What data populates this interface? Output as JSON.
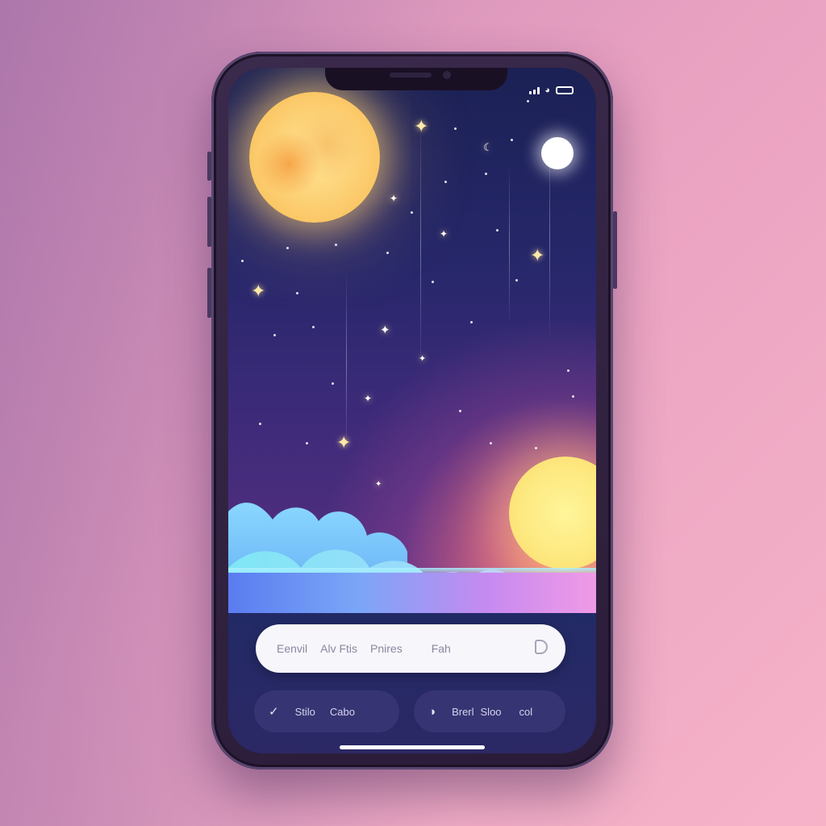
{
  "status_bar": {
    "icons": [
      "signal-icon",
      "wifi-icon",
      "battery-icon"
    ]
  },
  "search": {
    "segments": [
      "Eenvil",
      "Alv Ftis",
      "Pnires",
      "Fah"
    ],
    "icon": "search-icon"
  },
  "buttons": {
    "left": {
      "icon": "check-icon",
      "labels": [
        "Stilo",
        "Cabo"
      ]
    },
    "right": {
      "icon": "moon-icon",
      "labels": [
        "Brerl",
        "Sloo",
        "col"
      ]
    }
  },
  "colors": {
    "sky_top": "#1b2154",
    "sky_bottom": "#5a2f82",
    "panel": "#222a66",
    "pill": "#363472",
    "moon": "#fbc766",
    "sun": "#fde87e"
  }
}
